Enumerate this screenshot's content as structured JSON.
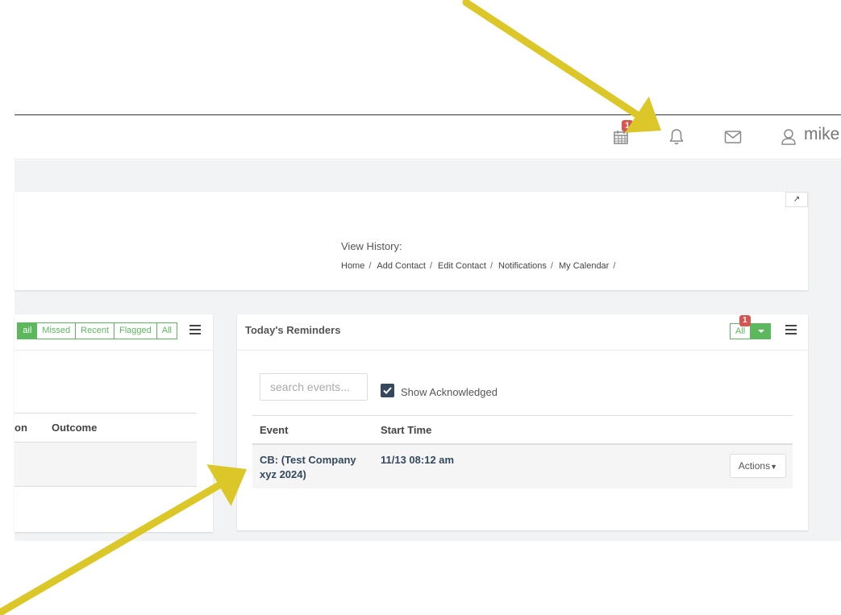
{
  "navbar": {
    "calendar_badge": "1",
    "user_name": "mike"
  },
  "history": {
    "label": "View History:",
    "crumbs": [
      "Home",
      "Add Contact",
      "Edit Contact",
      "Notifications",
      "My Calendar"
    ],
    "separator": "/"
  },
  "left_panel": {
    "filters": [
      "ail",
      "Missed",
      "Recent",
      "Flagged",
      "All"
    ],
    "columns": [
      "on",
      "Outcome"
    ]
  },
  "reminders": {
    "title": "Today's Reminders",
    "filter_label": "All",
    "filter_badge": "1",
    "search_placeholder": "search events...",
    "show_acknowledged_label": "Show Acknowledged",
    "columns": [
      "Event",
      "Start Time"
    ],
    "rows": [
      {
        "event": "CB: (Test Company xyz 2024)",
        "start_time": "11/13 08:12 am",
        "actions_label": "Actions"
      }
    ]
  },
  "annotation_color": "#dcc728"
}
